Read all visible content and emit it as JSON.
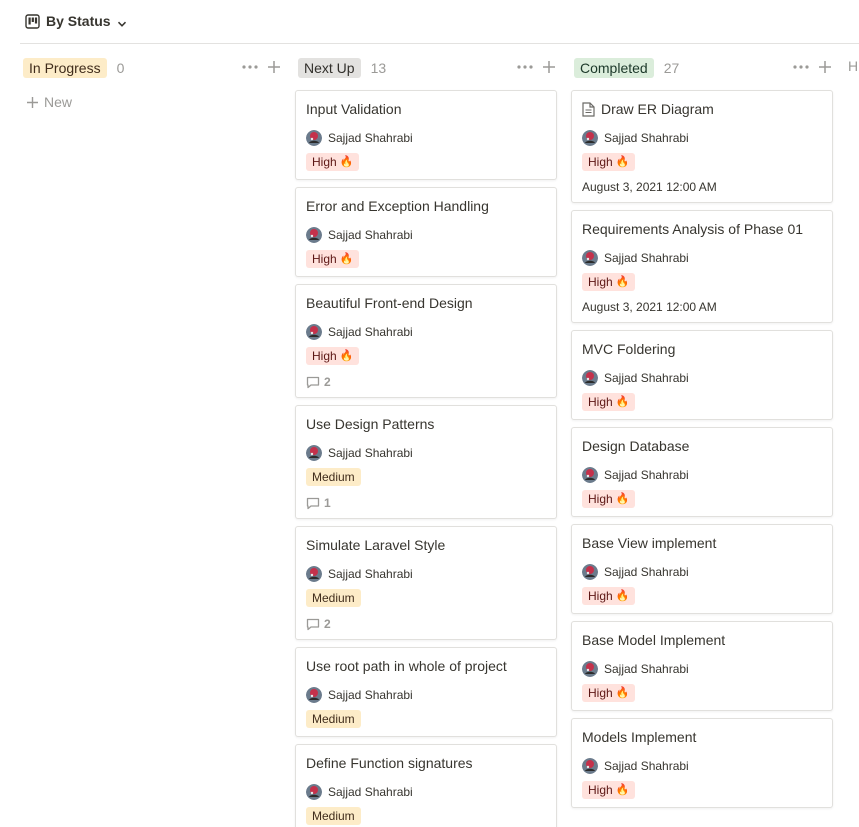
{
  "view": {
    "title": "By Status",
    "icon": "board-icon"
  },
  "colors": {
    "in_progress_bg": "#fdecc8",
    "next_up_bg": "#e3e2e0",
    "completed_bg": "#dbeddb",
    "high_bg": "#ffe2dd",
    "medium_bg": "#fdecc8"
  },
  "new_label": "New",
  "columns": [
    {
      "status": "In Progress",
      "count": "0",
      "cards": []
    },
    {
      "status": "Next Up",
      "count": "13",
      "cards": [
        {
          "title": "Input Validation",
          "assignee": "Sajjad Shahrabi",
          "priority": "High",
          "priority_icon": "🔥"
        },
        {
          "title": "Error and Exception Handling",
          "assignee": "Sajjad Shahrabi",
          "priority": "High",
          "priority_icon": "🔥"
        },
        {
          "title": "Beautiful Front-end Design",
          "assignee": "Sajjad Shahrabi",
          "priority": "High",
          "priority_icon": "🔥",
          "comments": "2"
        },
        {
          "title": "Use Design Patterns",
          "assignee": "Sajjad Shahrabi",
          "priority": "Medium",
          "comments": "1"
        },
        {
          "title": "Simulate Laravel Style",
          "assignee": "Sajjad Shahrabi",
          "priority": "Medium",
          "comments": "2"
        },
        {
          "title": "Use root path in whole of project",
          "assignee": "Sajjad Shahrabi",
          "priority": "Medium"
        },
        {
          "title": "Define Function signatures",
          "assignee": "Sajjad Shahrabi",
          "priority": "Medium"
        }
      ]
    },
    {
      "status": "Completed",
      "count": "27",
      "cards": [
        {
          "title": "Draw ER Diagram",
          "doc_icon": true,
          "assignee": "Sajjad Shahrabi",
          "priority": "High",
          "priority_icon": "🔥",
          "date": "August 3, 2021 12:00 AM"
        },
        {
          "title": "Requirements Analysis of Phase 01",
          "assignee": "Sajjad Shahrabi",
          "priority": "High",
          "priority_icon": "🔥",
          "date": "August 3, 2021 12:00 AM"
        },
        {
          "title": "MVC Foldering",
          "assignee": "Sajjad Shahrabi",
          "priority": "High",
          "priority_icon": "🔥"
        },
        {
          "title": "Design Database",
          "assignee": "Sajjad Shahrabi",
          "priority": "High",
          "priority_icon": "🔥"
        },
        {
          "title": "Base View implement",
          "assignee": "Sajjad Shahrabi",
          "priority": "High",
          "priority_icon": "🔥"
        },
        {
          "title": "Base Model Implement",
          "assignee": "Sajjad Shahrabi",
          "priority": "High",
          "priority_icon": "🔥"
        },
        {
          "title": "Models Implement",
          "assignee": "Sajjad Shahrabi",
          "priority": "High",
          "priority_icon": "🔥"
        }
      ]
    }
  ],
  "hidden_columns_label": "H"
}
